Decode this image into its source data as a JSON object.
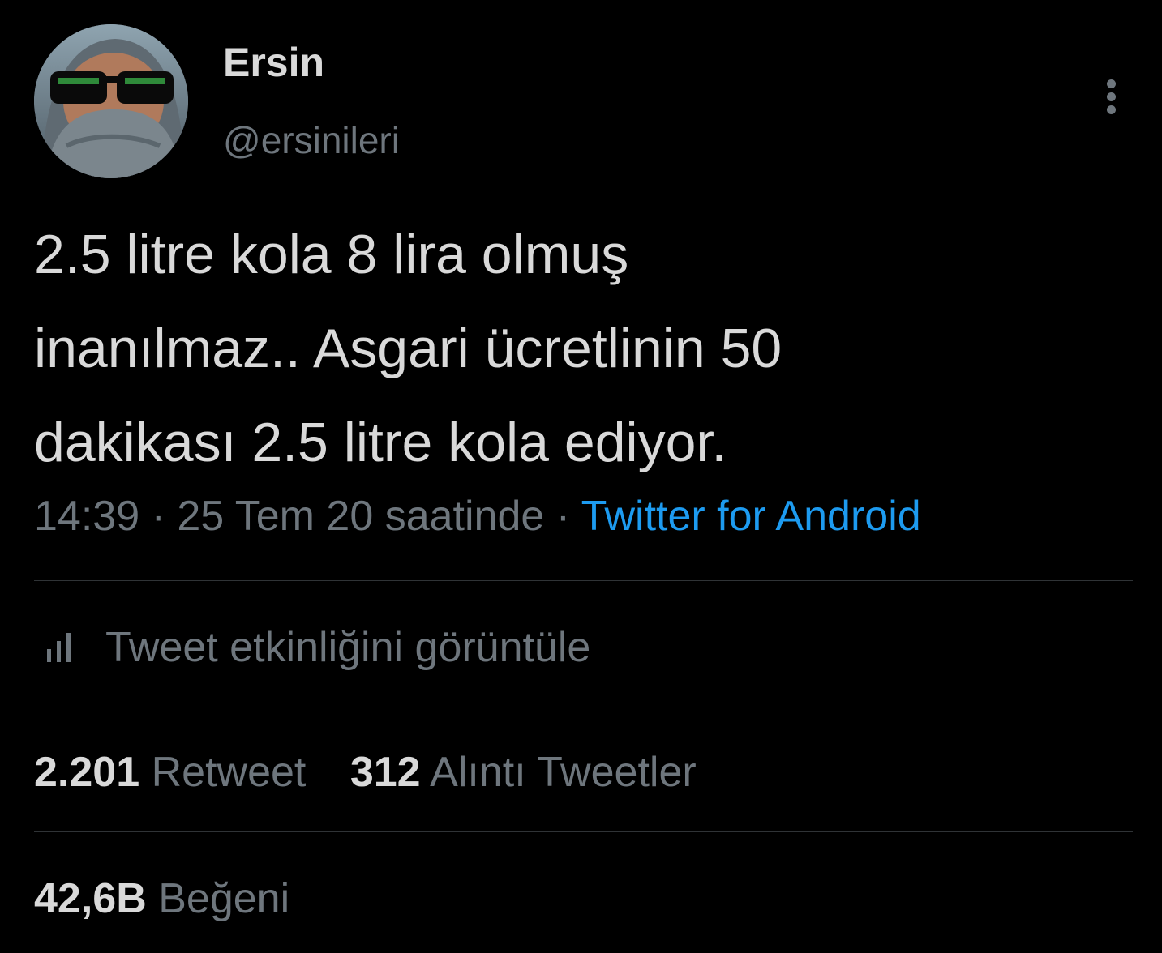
{
  "tweet": {
    "author": {
      "display_name": "Ersin",
      "handle": "@ersinileri",
      "avatar_icon": "avatar-photo"
    },
    "text_lines": [
      "2.5 litre kola 8 lira olmuş",
      "inanılmaz.. Asgari ücretlinin 50",
      "dakikası 2.5 litre kola ediyor."
    ],
    "time": "14:39",
    "separator": "·",
    "date": "25 Tem 20 saatinde",
    "source": "Twitter for Android",
    "more_icon": "more-vertical-icon"
  },
  "activity": {
    "label": "Tweet etkinliğini görüntüle",
    "icon": "analytics-bars-icon"
  },
  "stats": {
    "retweets_count": "2.201",
    "retweets_label": "Retweet",
    "quotes_count": "312",
    "quotes_label": "Alıntı Tweetler",
    "likes_count": "42,6B",
    "likes_label": "Beğeni"
  },
  "colors": {
    "background": "#000000",
    "primary_text": "#d9d9d9",
    "secondary_text": "#6e767d",
    "link": "#1d9bf0",
    "divider": "#2f3336"
  }
}
